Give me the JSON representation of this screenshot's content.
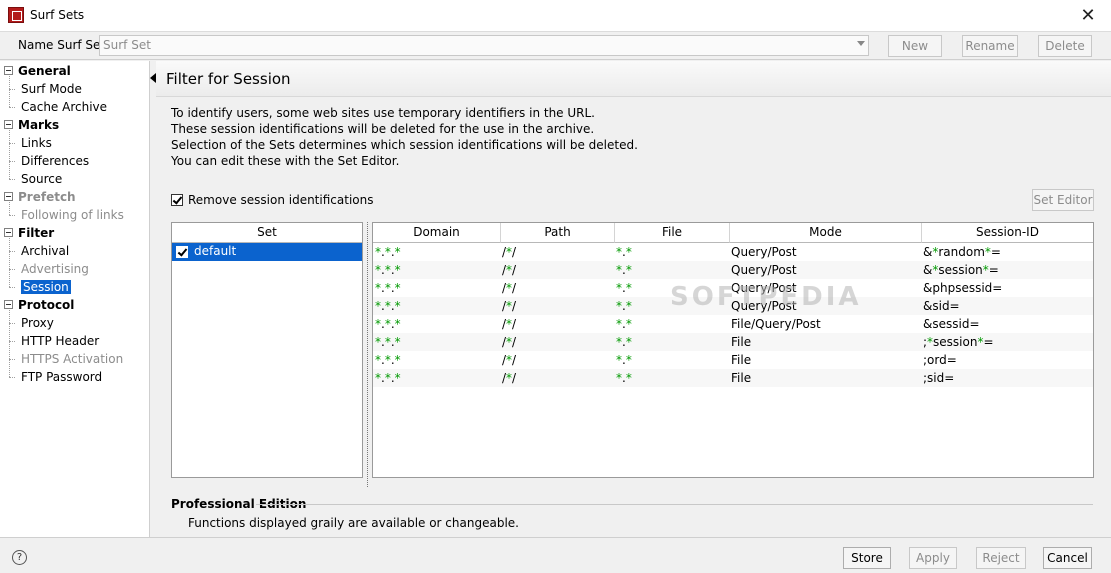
{
  "window": {
    "title": "Surf Sets",
    "close_icon": "close-icon"
  },
  "namebar": {
    "label": "Name Surf Set:",
    "value": "Surf Set",
    "buttons": {
      "new": "New",
      "rename": "Rename",
      "delete": "Delete"
    }
  },
  "sidebar": {
    "groups": [
      {
        "label": "General",
        "disabled": false,
        "items": [
          {
            "label": "Surf Mode",
            "disabled": false
          },
          {
            "label": "Cache Archive",
            "disabled": false
          }
        ]
      },
      {
        "label": "Marks",
        "disabled": false,
        "items": [
          {
            "label": "Links",
            "disabled": false
          },
          {
            "label": "Differences",
            "disabled": false
          },
          {
            "label": "Source",
            "disabled": false
          }
        ]
      },
      {
        "label": "Prefetch",
        "disabled": true,
        "items": [
          {
            "label": "Following of links",
            "disabled": true
          }
        ]
      },
      {
        "label": "Filter",
        "disabled": false,
        "items": [
          {
            "label": "Archival",
            "disabled": false
          },
          {
            "label": "Advertising",
            "disabled": true
          },
          {
            "label": "Session",
            "disabled": false,
            "selected": true
          }
        ]
      },
      {
        "label": "Protocol",
        "disabled": false,
        "items": [
          {
            "label": "Proxy",
            "disabled": false
          },
          {
            "label": "HTTP Header",
            "disabled": false
          },
          {
            "label": "HTTPS Activation",
            "disabled": true
          },
          {
            "label": "FTP Password",
            "disabled": false
          }
        ]
      }
    ]
  },
  "content": {
    "title": "Filter for Session",
    "description": [
      "To identify users, some web sites use temporary identifiers in the URL.",
      "These session identifications will be deleted for the use in the archive.",
      "Selection of the Sets determines which session identifications will be deleted.",
      "You can edit these with the Set Editor."
    ],
    "remove_checkbox": {
      "label": "Remove session identifications",
      "checked": true
    },
    "set_editor_button": "Set Editor",
    "set_table": {
      "header": "Set",
      "rows": [
        {
          "name": "default",
          "checked": true
        }
      ]
    },
    "rules_table": {
      "columns": [
        "Domain",
        "Path",
        "File",
        "Mode",
        "Session-ID"
      ],
      "rows": [
        {
          "domain": [
            [
              "*",
              "g"
            ],
            [
              ".",
              ""
            ],
            [
              "*",
              "g"
            ],
            [
              ".",
              ""
            ],
            [
              "*",
              "g"
            ]
          ],
          "path": [
            [
              "/",
              ""
            ],
            [
              "*",
              "g"
            ],
            [
              "/",
              ""
            ]
          ],
          "file": [
            [
              "*",
              "g"
            ],
            [
              ".",
              ""
            ],
            [
              "*",
              "g"
            ]
          ],
          "mode": "Query/Post",
          "sid": [
            [
              "&",
              ""
            ],
            [
              "*",
              "g"
            ],
            [
              "random",
              ""
            ],
            [
              "*",
              "g"
            ],
            [
              "=",
              ""
            ]
          ]
        },
        {
          "domain": [
            [
              "*",
              "g"
            ],
            [
              ".",
              ""
            ],
            [
              "*",
              "g"
            ],
            [
              ".",
              ""
            ],
            [
              "*",
              "g"
            ]
          ],
          "path": [
            [
              "/",
              ""
            ],
            [
              "*",
              "g"
            ],
            [
              "/",
              ""
            ]
          ],
          "file": [
            [
              "*",
              "g"
            ],
            [
              ".",
              ""
            ],
            [
              "*",
              "g"
            ]
          ],
          "mode": "Query/Post",
          "sid": [
            [
              "&",
              ""
            ],
            [
              "*",
              "g"
            ],
            [
              "session",
              ""
            ],
            [
              "*",
              "g"
            ],
            [
              "=",
              ""
            ]
          ]
        },
        {
          "domain": [
            [
              "*",
              "g"
            ],
            [
              ".",
              ""
            ],
            [
              "*",
              "g"
            ],
            [
              ".",
              ""
            ],
            [
              "*",
              "g"
            ]
          ],
          "path": [
            [
              "/",
              ""
            ],
            [
              "*",
              "g"
            ],
            [
              "/",
              ""
            ]
          ],
          "file": [
            [
              "*",
              "g"
            ],
            [
              ".",
              ""
            ],
            [
              "*",
              "g"
            ]
          ],
          "mode": "Query/Post",
          "sid": [
            [
              "&phpsessid=",
              ""
            ]
          ]
        },
        {
          "domain": [
            [
              "*",
              "g"
            ],
            [
              ".",
              ""
            ],
            [
              "*",
              "g"
            ],
            [
              ".",
              ""
            ],
            [
              "*",
              "g"
            ]
          ],
          "path": [
            [
              "/",
              ""
            ],
            [
              "*",
              "g"
            ],
            [
              "/",
              ""
            ]
          ],
          "file": [
            [
              "*",
              "g"
            ],
            [
              ".",
              ""
            ],
            [
              "*",
              "g"
            ]
          ],
          "mode": "Query/Post",
          "sid": [
            [
              "&sid=",
              ""
            ]
          ]
        },
        {
          "domain": [
            [
              "*",
              "g"
            ],
            [
              ".",
              ""
            ],
            [
              "*",
              "g"
            ],
            [
              ".",
              ""
            ],
            [
              "*",
              "g"
            ]
          ],
          "path": [
            [
              "/",
              ""
            ],
            [
              "*",
              "g"
            ],
            [
              "/",
              ""
            ]
          ],
          "file": [
            [
              "*",
              "g"
            ],
            [
              ".",
              ""
            ],
            [
              "*",
              "g"
            ]
          ],
          "mode": "File/Query/Post",
          "sid": [
            [
              "&sessid=",
              ""
            ]
          ]
        },
        {
          "domain": [
            [
              "*",
              "g"
            ],
            [
              ".",
              ""
            ],
            [
              "*",
              "g"
            ],
            [
              ".",
              ""
            ],
            [
              "*",
              "g"
            ]
          ],
          "path": [
            [
              "/",
              ""
            ],
            [
              "*",
              "g"
            ],
            [
              "/",
              ""
            ]
          ],
          "file": [
            [
              "*",
              "g"
            ],
            [
              ".",
              ""
            ],
            [
              "*",
              "g"
            ]
          ],
          "mode": "File",
          "sid": [
            [
              ";",
              ""
            ],
            [
              "*",
              "g"
            ],
            [
              "session",
              ""
            ],
            [
              "*",
              "g"
            ],
            [
              "=",
              ""
            ]
          ]
        },
        {
          "domain": [
            [
              "*",
              "g"
            ],
            [
              ".",
              ""
            ],
            [
              "*",
              "g"
            ],
            [
              ".",
              ""
            ],
            [
              "*",
              "g"
            ]
          ],
          "path": [
            [
              "/",
              ""
            ],
            [
              "*",
              "g"
            ],
            [
              "/",
              ""
            ]
          ],
          "file": [
            [
              "*",
              "g"
            ],
            [
              ".",
              ""
            ],
            [
              "*",
              "g"
            ]
          ],
          "mode": "File",
          "sid": [
            [
              ";ord=",
              ""
            ]
          ]
        },
        {
          "domain": [
            [
              "*",
              "g"
            ],
            [
              ".",
              ""
            ],
            [
              "*",
              "g"
            ],
            [
              ".",
              ""
            ],
            [
              "*",
              "g"
            ]
          ],
          "path": [
            [
              "/",
              ""
            ],
            [
              "*",
              "g"
            ],
            [
              "/",
              ""
            ]
          ],
          "file": [
            [
              "*",
              "g"
            ],
            [
              ".",
              ""
            ],
            [
              "*",
              "g"
            ]
          ],
          "mode": "File",
          "sid": [
            [
              ";sid=",
              ""
            ]
          ]
        }
      ]
    },
    "professional": {
      "title": "Professional Edition",
      "description": "Functions displayed graily are available or changeable."
    }
  },
  "footer": {
    "help_icon": "help-icon",
    "help_glyph": "?",
    "buttons": {
      "store": "Store",
      "apply": "Apply",
      "reject": "Reject",
      "cancel": "Cancel"
    }
  },
  "watermark": "SOFTPEDIA",
  "colors": {
    "selection": "#0b63ce",
    "wildcard": "#009900",
    "disabled": "#8c8c8c"
  }
}
